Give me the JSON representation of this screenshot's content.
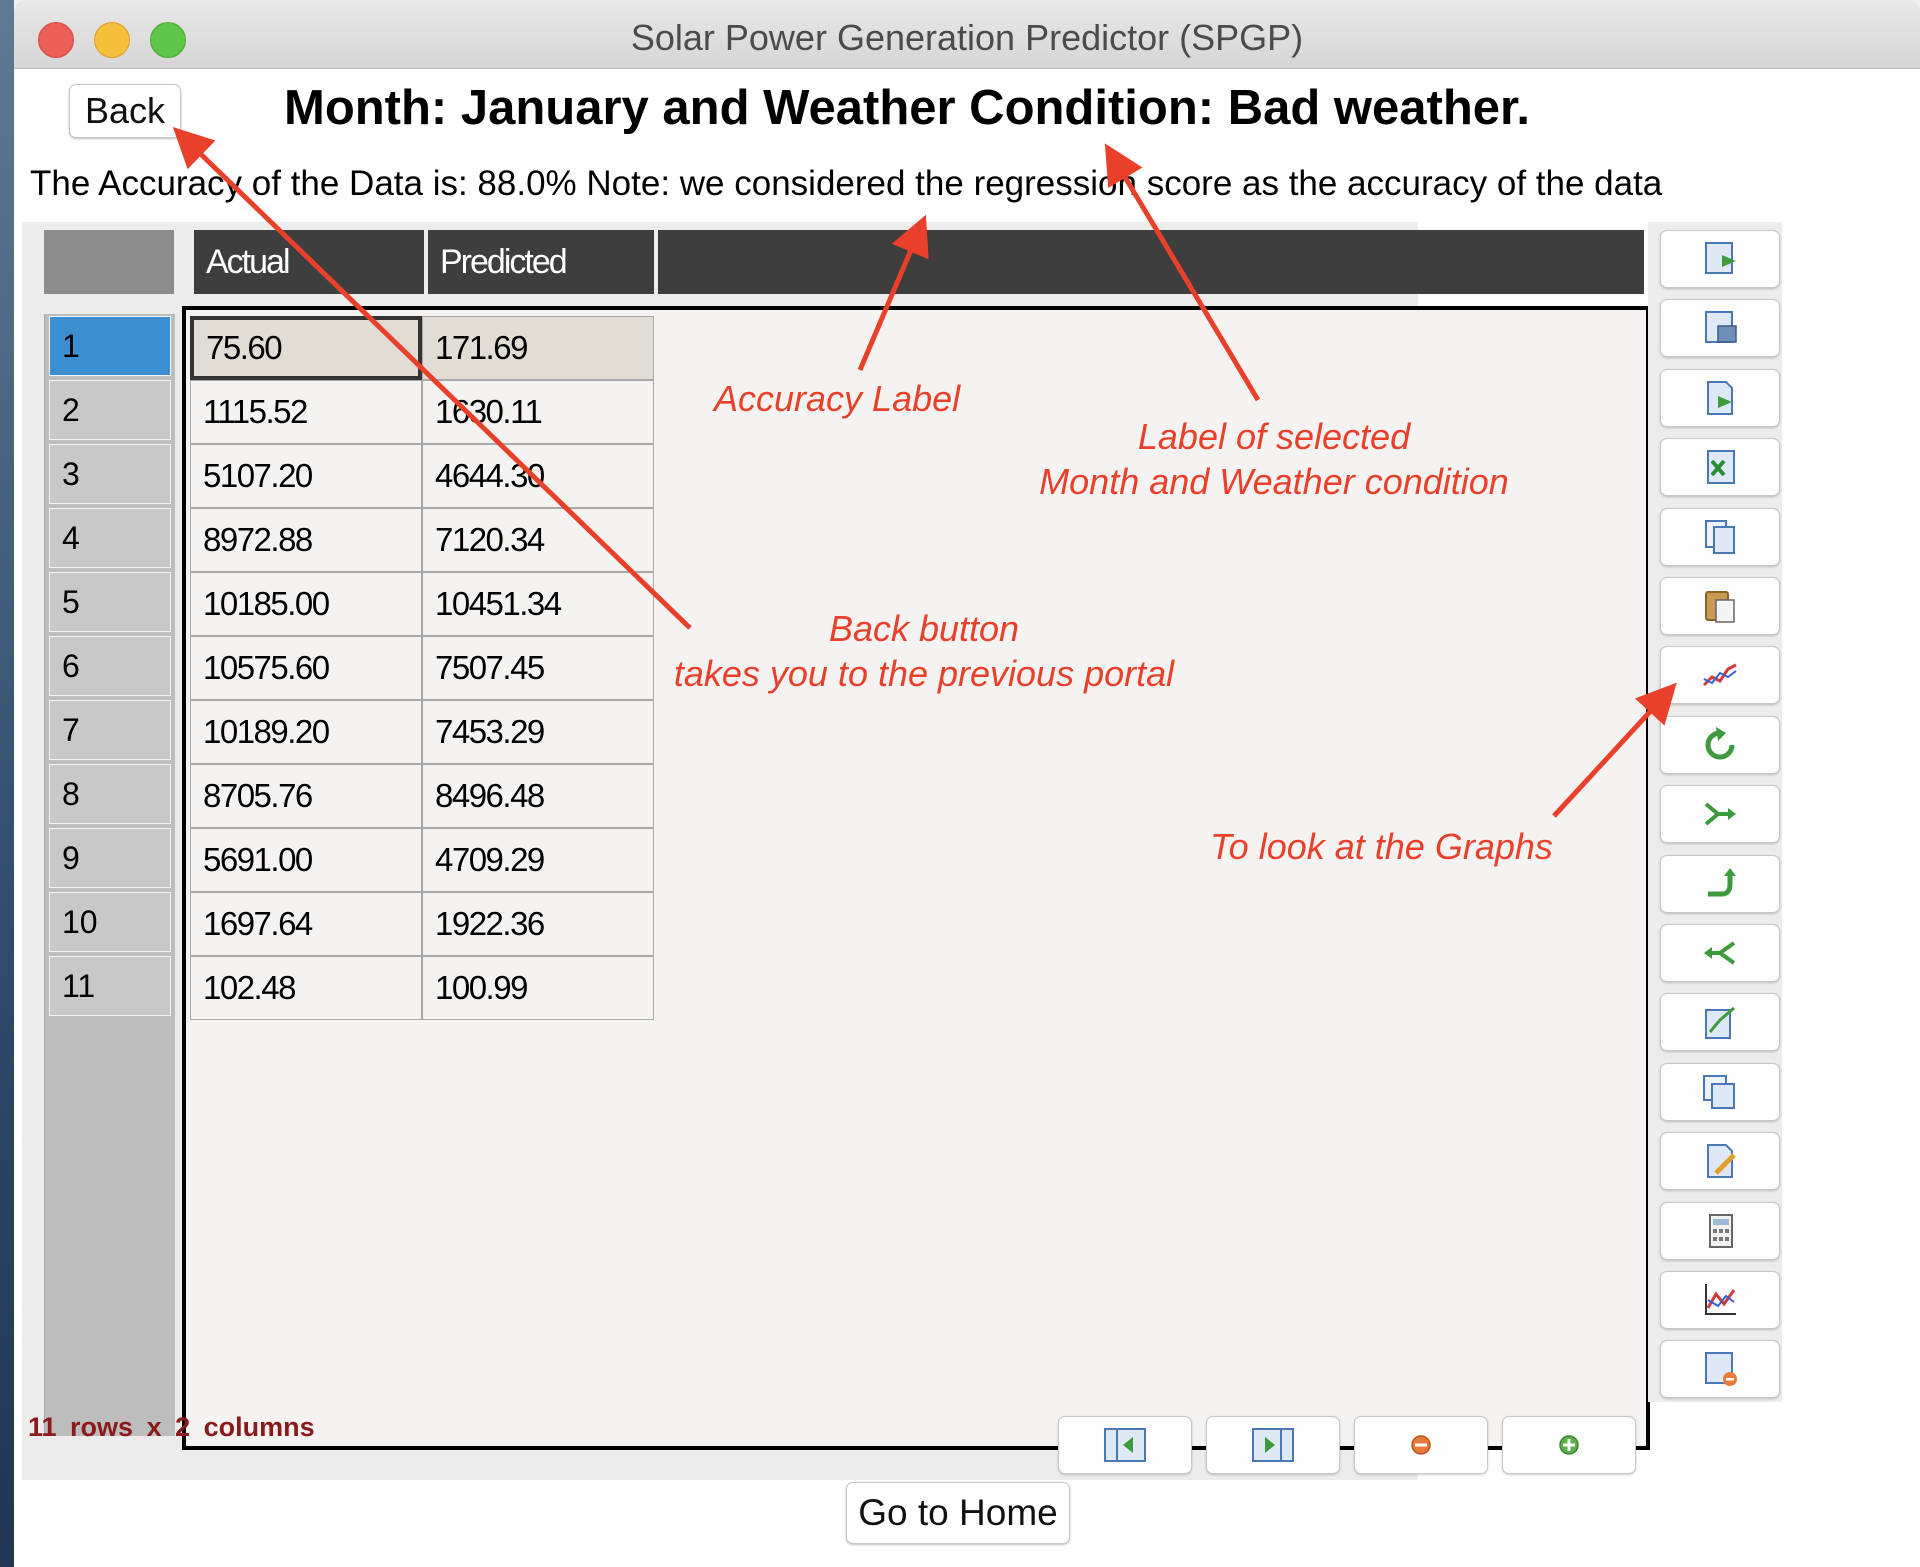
{
  "window": {
    "title": "Solar Power Generation Predictor (SPGP)"
  },
  "back_label": "Back",
  "heading": "Month: January and Weather Condition: Bad weather.",
  "accuracy_text": "The Accuracy of the Data is: 88.0% Note: we considered the regression score as the accuracy of the data",
  "table": {
    "columns": [
      "Actual",
      "Predicted"
    ],
    "rows": [
      {
        "n": "1",
        "actual": "75.60",
        "predicted": "171.69"
      },
      {
        "n": "2",
        "actual": "1115.52",
        "predicted": "1630.11"
      },
      {
        "n": "3",
        "actual": "5107.20",
        "predicted": "4644.30"
      },
      {
        "n": "4",
        "actual": "8972.88",
        "predicted": "7120.34"
      },
      {
        "n": "5",
        "actual": "10185.00",
        "predicted": "10451.34"
      },
      {
        "n": "6",
        "actual": "10575.60",
        "predicted": "7507.45"
      },
      {
        "n": "7",
        "actual": "10189.20",
        "predicted": "7453.29"
      },
      {
        "n": "8",
        "actual": "8705.76",
        "predicted": "8496.48"
      },
      {
        "n": "9",
        "actual": "5691.00",
        "predicted": "4709.29"
      },
      {
        "n": "10",
        "actual": "1697.64",
        "predicted": "1922.36"
      },
      {
        "n": "11",
        "actual": "102.48",
        "predicted": "100.99"
      }
    ],
    "selected_row": "1",
    "status": "11  rows  x  2  columns"
  },
  "toolbar_icons": [
    "export-icon",
    "save-icon",
    "import-icon",
    "excel-icon",
    "copy-icon",
    "paste-icon",
    "graph-icon",
    "refresh-icon",
    "merge-icon",
    "reshape-icon",
    "split-icon",
    "transform-icon",
    "duplicate-icon",
    "edit-icon",
    "calculator-icon",
    "chart-icon",
    "delete-table-icon"
  ],
  "nav_icons": [
    "previous-icon",
    "next-icon",
    "remove-row-icon",
    "add-row-icon"
  ],
  "home_label": "Go to Home",
  "annotations": {
    "accuracy": "Accuracy Label",
    "month_weather_1": "Label of selected",
    "month_weather_2": "Month and Weather condition",
    "back_1": "Back button",
    "back_2": "takes you to the previous portal",
    "graphs": "To look at the Graphs"
  },
  "colors": {
    "annotation": "#e8402a",
    "selected_row": "#3b8fd0",
    "header_bg": "#3e3e3e",
    "status_text": "#8b1a1a"
  }
}
